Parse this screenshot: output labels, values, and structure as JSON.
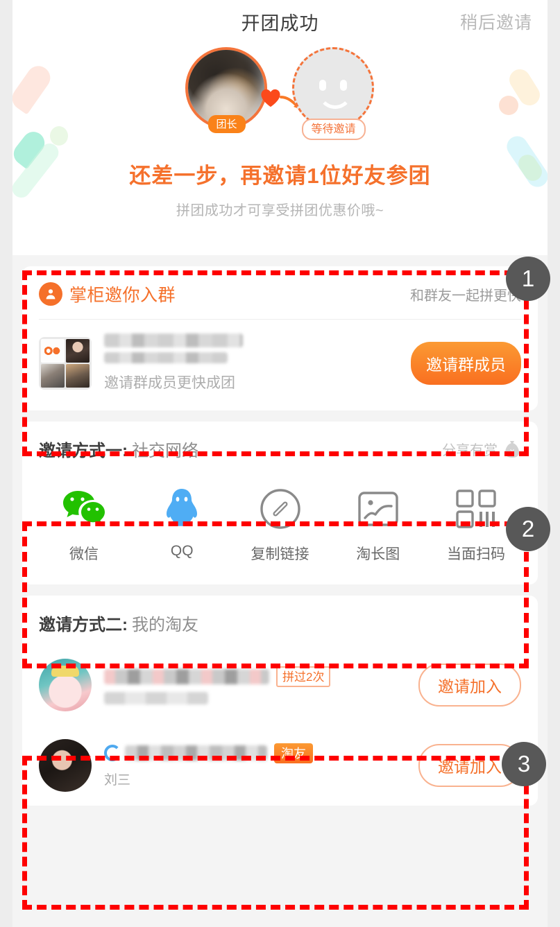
{
  "hero": {
    "title": "开团成功",
    "later_link": "稍后邀请",
    "leader_badge": "团长",
    "waiting_badge": "等待邀请",
    "headline": "还差一步，再邀请1位好友参团",
    "subtitle": "拼团成功才可享受拼团优惠价哦~",
    "leader_avatar_icon": "leader-avatar-photo",
    "waiting_avatar_icon": "waiting-placeholder-face-icon",
    "heart_icon": "heart-icon",
    "arrow_icon": "arrow-right-icon"
  },
  "group_card": {
    "icon": "group-people-icon",
    "title": "掌柜邀你入群",
    "hint": "和群友一起拼更快",
    "group_name_masked": "",
    "subtitle": "邀请群成员更快成团",
    "button_label": "邀请群成员",
    "avatar_grid_icon": "group-avatar-grid"
  },
  "social_section": {
    "label": "邀请方式一:",
    "value": "社交网络",
    "reward_text": "分享有赏",
    "reward_icon": "money-bag-icon",
    "items": [
      {
        "label": "微信",
        "icon": "wechat-icon",
        "color": "#22c100"
      },
      {
        "label": "QQ",
        "icon": "qq-penguin-icon",
        "color": "#4fadf4"
      },
      {
        "label": "复制链接",
        "icon": "link-copy-icon",
        "color": "#8a8a8a"
      },
      {
        "label": "淘长图",
        "icon": "image-picture-icon",
        "color": "#8a8a8a"
      },
      {
        "label": "当面扫码",
        "icon": "qr-code-icon",
        "color": "#8a8a8a"
      }
    ]
  },
  "friends_section": {
    "label": "邀请方式二:",
    "value": "我的淘友",
    "rows": [
      {
        "avatar_icon": "friend-avatar-cartoon",
        "name_masked": "",
        "second_line_masked": "",
        "badge": "拼过2次",
        "badge_style": "outline",
        "button_label": "邀请加入"
      },
      {
        "avatar_icon": "friend-avatar-photo",
        "name_masked": "",
        "name_prefix_icon": "qq-circle-icon",
        "badge": "淘友",
        "badge_style": "solid",
        "nickname": "刘三",
        "button_label": "邀请加入"
      }
    ]
  },
  "annotations": {
    "marker1": "1",
    "marker2": "2",
    "marker3": "3",
    "box_color": "#fe0000",
    "marker_color": "#585858"
  },
  "colors": {
    "brand_orange": "#f5702a",
    "orange_gradient_start": "#fb9a33",
    "orange_gradient_end": "#f96f20",
    "title_gray": "#3d3d3d",
    "muted_gray": "#b5b5b5"
  }
}
